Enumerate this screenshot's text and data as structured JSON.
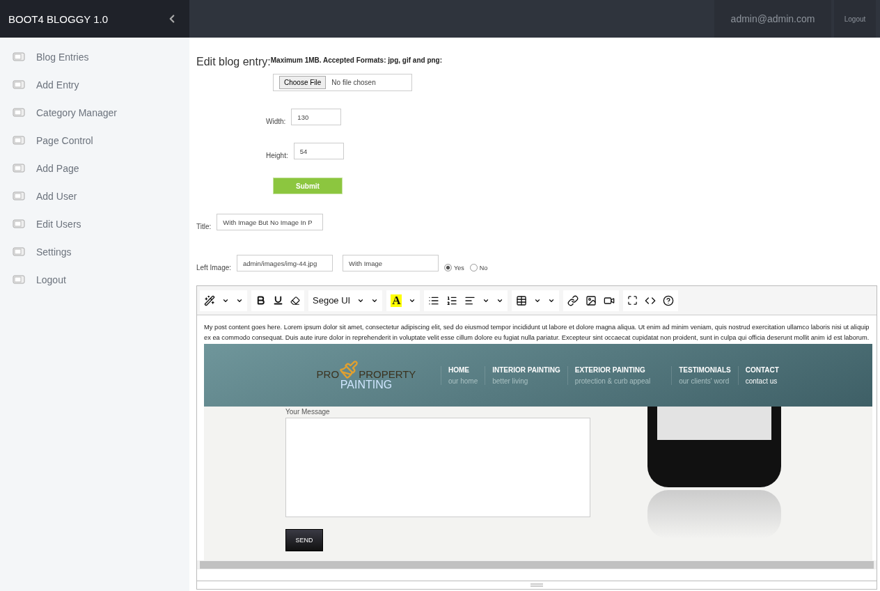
{
  "brand": "BOOT4 BLOGGY 1.0",
  "sidebar": {
    "items": [
      {
        "label": "Blog Entries"
      },
      {
        "label": "Add Entry"
      },
      {
        "label": "Category Manager"
      },
      {
        "label": "Page Control"
      },
      {
        "label": "Add Page"
      },
      {
        "label": "Add User"
      },
      {
        "label": "Edit Users"
      },
      {
        "label": "Settings"
      },
      {
        "label": "Logout"
      }
    ]
  },
  "header": {
    "user": "admin@admin.com",
    "logout": "Logout"
  },
  "form": {
    "heading": "Edit blog entry:",
    "upload_note": "Maximum 1MB. Accepted Formats: jpg, gif and png:",
    "file_button": "Choose File",
    "file_status": "No file chosen",
    "width": {
      "label": "Width:",
      "value": "130"
    },
    "height": {
      "label": "Height:",
      "value": "54"
    },
    "submit": "Submit",
    "title": {
      "label": "Title:",
      "value": "With Image But No Image In P"
    },
    "left_image": {
      "label": "Left Image:",
      "path": "admin/images/img-44.jpg",
      "caption": "With Image",
      "options": [
        {
          "label": "Yes",
          "selected": true
        },
        {
          "label": "No",
          "selected": false
        }
      ]
    }
  },
  "editor": {
    "font": "Segoe UI",
    "color_letter": "A",
    "content": "My post content goes here. Lorem ipsum dolor sit amet, consectetur adipiscing elit, sed do eiusmod tempor incididunt ut labore et dolore magna aliqua. Ut enim ad minim veniam, quis nostrud exercitation ullamco laboris nisi ut aliquip ex ea commodo consequat. Duis aute irure dolor in reprehenderit in voluptate velit esse cillum dolore eu fugiat nulla pariatur. Excepteur sint occaecat cupidatat non proident, sunt in culpa qui officia deserunt mollit anim id est laborum.",
    "embedded_page": {
      "logo": {
        "left": "PRO",
        "right": "PROPERTY",
        "bottom": "PAINTING"
      },
      "nav": [
        {
          "title": "HOME",
          "subtitle": "our home",
          "selected": false
        },
        {
          "title": "INTERIOR PAINTING",
          "subtitle": "better living",
          "selected": false
        },
        {
          "title": "EXTERIOR PAINTING",
          "subtitle": "protection & curb appeal",
          "selected": false
        },
        {
          "title": "TESTIMONIALS",
          "subtitle": "our clients' word",
          "selected": false
        },
        {
          "title": "CONTACT",
          "subtitle": "contact us",
          "selected": true
        }
      ],
      "message_label": "Your Message",
      "send": "SEND"
    }
  }
}
